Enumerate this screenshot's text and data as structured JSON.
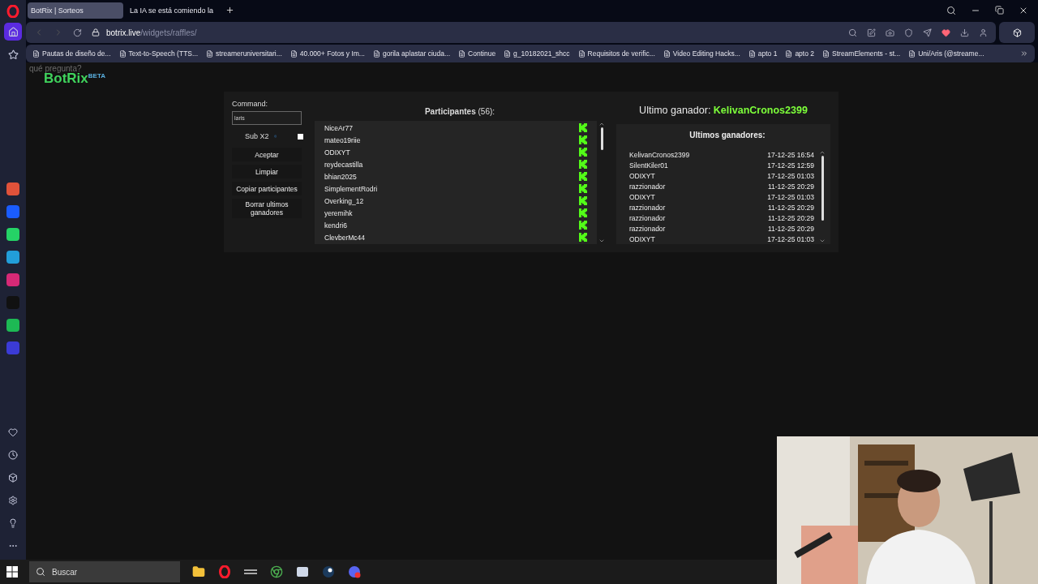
{
  "browser": {
    "tabs": [
      {
        "title": "BotRix | Sorteos",
        "selected": true
      },
      {
        "title": "La IA se está comiendo la",
        "selected": false
      }
    ],
    "address": {
      "host": "botrix.live",
      "path": "/widgets/raffles/"
    },
    "bookmarks": [
      "Pautas de diseño de...",
      "Text-to-Speech (TTS...",
      "streameruniversitari...",
      "40.000+ Fotos y Im...",
      "gorila aplastar ciuda...",
      "Continue",
      "g_10182021_shcc",
      "Requisitos de verific...",
      "Video Editing Hacks...",
      "apto 1",
      "apto 2",
      "StreamElements - st...",
      "Uni/Aris (@streame..."
    ]
  },
  "overlay_text": "qué pregunta?",
  "logo": {
    "name": "BotRix",
    "badge": "BETA"
  },
  "controls": {
    "command_label": "Command:",
    "command_value": "laris",
    "sub_label": "Sub X2",
    "sub_checked": false,
    "buttons": [
      "Aceptar",
      "Limpiar",
      "Copiar participantes",
      "Borrar ultimos ganadores"
    ]
  },
  "participants": {
    "title": "Participantes",
    "count": "(56):",
    "rows": [
      "NiceAr77",
      "mateo19riie",
      "ODIXYT",
      "reydecastilla",
      "bhian2025",
      "SimplementRodri",
      "Overking_12",
      "yeremihk",
      "kendri6",
      "ClevberMc44"
    ]
  },
  "last_winner": {
    "label": "Ultimo ganador:",
    "name": "KelivanCronos2399"
  },
  "winners": {
    "title": "Ultimos ganadores:",
    "rows": [
      {
        "name": "KelivanCronos2399",
        "time": "17-12-25 16:54"
      },
      {
        "name": "SilentKiler01",
        "time": "17-12-25 12:59"
      },
      {
        "name": "ODIXYT",
        "time": "17-12-25 01:03"
      },
      {
        "name": "razzionador",
        "time": "11-12-25 20:29"
      },
      {
        "name": "ODIXYT",
        "time": "17-12-25 01:03"
      },
      {
        "name": "razzionador",
        "time": "11-12-25 20:29"
      },
      {
        "name": "razzionador",
        "time": "11-12-25 20:29"
      },
      {
        "name": "razzionador",
        "time": "11-12-25 20:29"
      },
      {
        "name": "ODIXYT",
        "time": "17-12-25 01:03"
      }
    ]
  },
  "taskbar": {
    "search_placeholder": "Buscar"
  }
}
